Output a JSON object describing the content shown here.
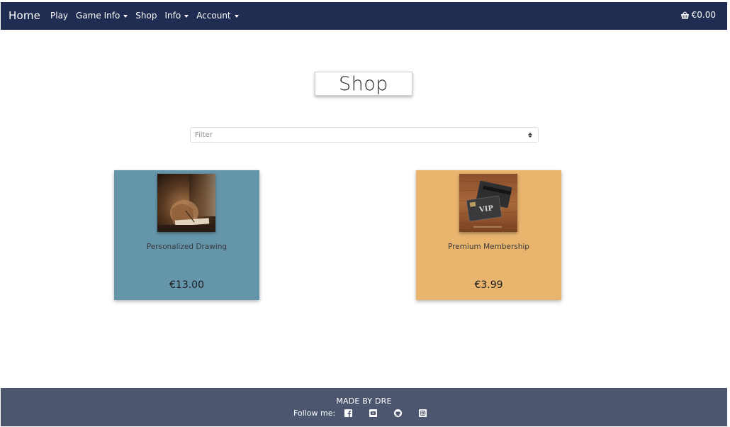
{
  "navbar": {
    "brand": "Home",
    "items": [
      {
        "label": "Play",
        "dropdown": false
      },
      {
        "label": "Game Info",
        "dropdown": true
      },
      {
        "label": "Shop",
        "dropdown": false
      },
      {
        "label": "Info",
        "dropdown": true
      },
      {
        "label": "Account",
        "dropdown": true
      }
    ],
    "cart_total": "€0.00",
    "cart_icon": "basket-icon"
  },
  "page": {
    "title": "Shop"
  },
  "filter": {
    "placeholder": "Filter"
  },
  "products": [
    {
      "name": "Personalized Drawing",
      "price": "€13.00",
      "bg": "#6595aa",
      "image": "drawing-photo"
    },
    {
      "name": "Premium Membership",
      "price": "€3.99",
      "bg": "#e8b46e",
      "image": "vip-cards-photo"
    }
  ],
  "footer": {
    "made_by": "MADE BY DRE",
    "follow_label": "Follow me:",
    "socials": [
      "facebook-icon",
      "youtube-icon",
      "github-icon",
      "instagram-icon"
    ]
  },
  "colors": {
    "navbar": "#202c52",
    "footer": "#4c566e"
  }
}
